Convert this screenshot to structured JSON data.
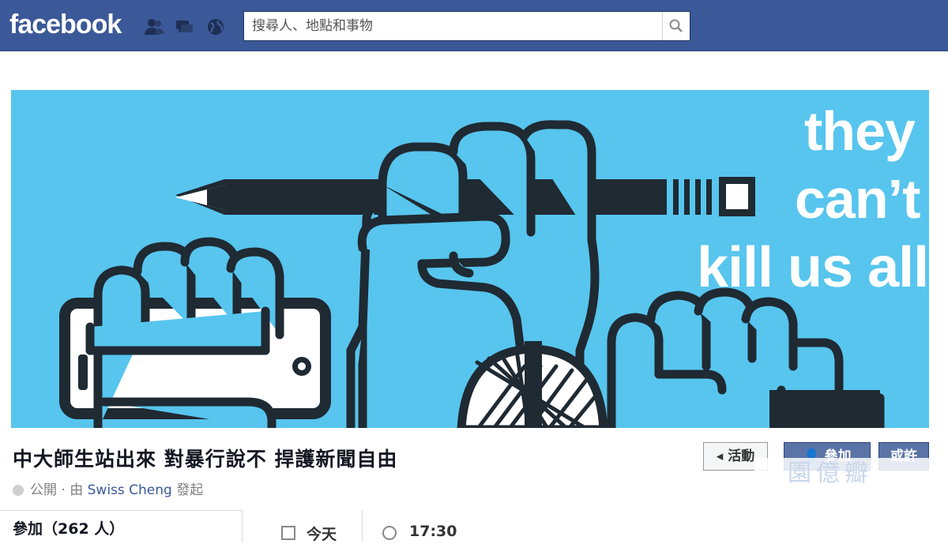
{
  "topbar": {
    "logo": "facebook",
    "search_placeholder": "搜尋人、地點和事物",
    "icons": [
      "friend-requests-icon",
      "messages-icon",
      "notifications-icon",
      "search-icon"
    ]
  },
  "cover": {
    "slogan_line1": "they",
    "slogan_line2": "can’t",
    "slogan_line3": "kill us all",
    "background_color": "#57c5ee",
    "ink_color": "#1f2a33"
  },
  "event": {
    "title": "中大師生站出來 對暴行說不 捍護新聞自由",
    "privacy": "公開",
    "by": "· 由",
    "organizer": "Swiss Cheng",
    "started": "發起",
    "buttons": {
      "event": "◂ 活動",
      "join": "參加",
      "maybe": "或許"
    }
  },
  "watermark": "園億瓣",
  "details": {
    "going": "參加（262 人）",
    "date": "今天",
    "time": "17:30"
  }
}
